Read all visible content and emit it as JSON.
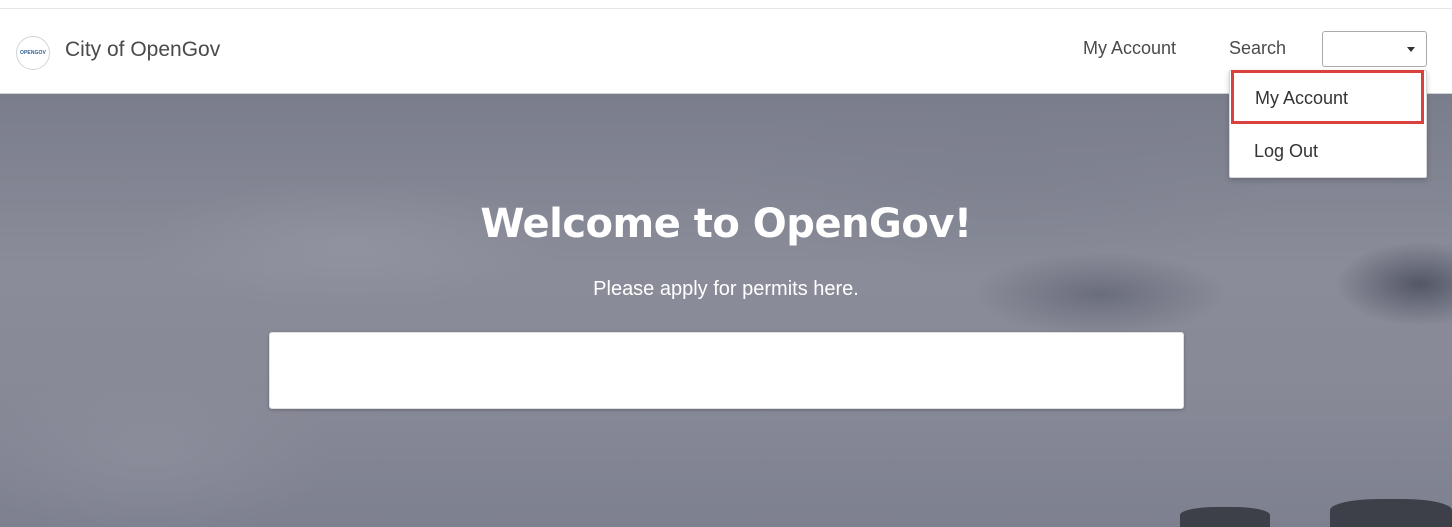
{
  "header": {
    "logo_text": "OPENGOV",
    "site_title": "City of OpenGov",
    "nav": {
      "my_account": "My Account",
      "search": "Search"
    },
    "select_value": ""
  },
  "dropdown": {
    "items": [
      {
        "label": "My Account",
        "highlighted": true
      },
      {
        "label": "Log Out"
      }
    ],
    "highlight_color": "#d9403e"
  },
  "hero": {
    "title": "Welcome to OpenGov!",
    "subtitle": "Please apply for permits here.",
    "search_value": ""
  },
  "colors": {
    "header_text": "#4a4a4a",
    "hero_text": "#ffffff",
    "logo_accent": "#2e5d8c"
  }
}
